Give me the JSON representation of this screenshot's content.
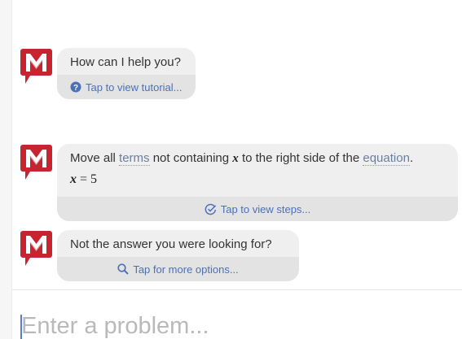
{
  "messages": [
    {
      "text": "How can I help you?",
      "footer": "Tap to view tutorial..."
    },
    {
      "text_before": "Move all ",
      "link_terms": "terms",
      "text_mid": " not containing ",
      "variable": "x",
      "text_after": " to the right side of the ",
      "link_equation": "equation",
      "text_end": ".",
      "math_var": "x",
      "math_rest": " = 5",
      "footer": "Tap to view steps..."
    },
    {
      "text": "Not the answer you were looking for?",
      "footer": "Tap for more options..."
    }
  ],
  "input": {
    "placeholder": "Enter a problem..."
  },
  "colors": {
    "accent": "#4a70b8",
    "logo_red": "#c8242f",
    "bubble_bg": "#efefef",
    "footer_bg": "#e3e3e3"
  }
}
